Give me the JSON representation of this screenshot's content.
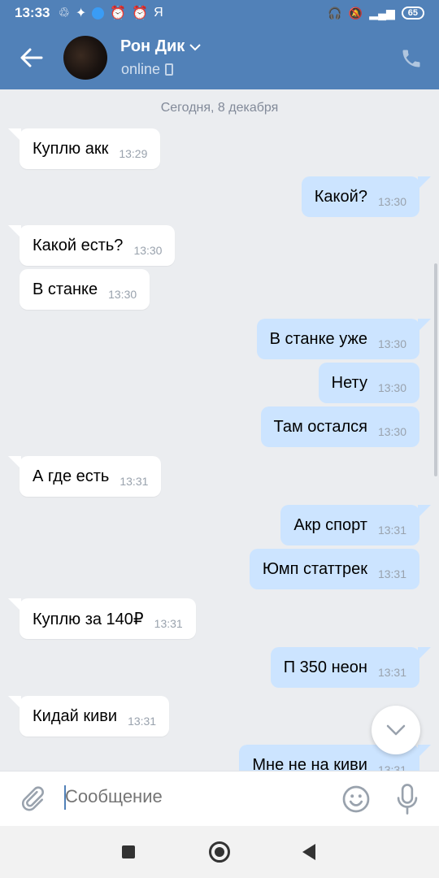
{
  "status": {
    "time": "13:33",
    "battery": "65",
    "carrier_glyph": "Я"
  },
  "contact": {
    "name": "Рон Дик",
    "presence": "online"
  },
  "chat": {
    "date_label": "Сегодня, 8 декабря",
    "messages": [
      {
        "dir": "in",
        "text": "Куплю акк",
        "time": "13:29"
      },
      {
        "dir": "out",
        "text": "Какой?",
        "time": "13:30"
      },
      {
        "dir": "in",
        "text": "Какой есть?",
        "time": "13:30"
      },
      {
        "dir": "in",
        "text": "В станке",
        "time": "13:30"
      },
      {
        "dir": "out",
        "text": "В станке уже",
        "time": "13:30"
      },
      {
        "dir": "out",
        "text": "Нету",
        "time": "13:30"
      },
      {
        "dir": "out",
        "text": "Там остался",
        "time": "13:30"
      },
      {
        "dir": "in",
        "text": "А где есть",
        "time": "13:31"
      },
      {
        "dir": "out",
        "text": "Акр спорт",
        "time": "13:31"
      },
      {
        "dir": "out",
        "text": "Юмп статтрек",
        "time": "13:31"
      },
      {
        "dir": "in",
        "text": "Куплю за 140₽",
        "time": "13:31"
      },
      {
        "dir": "out",
        "text": "П 350 неон",
        "time": "13:31"
      },
      {
        "dir": "in",
        "text": "Кидай киви",
        "time": "13:31"
      },
      {
        "dir": "out",
        "text": "Мне не на киви",
        "time": "13:31"
      }
    ]
  },
  "composer": {
    "placeholder": "Сообщение"
  },
  "icons": {
    "back": "arrow-left-icon",
    "phone": "phone-icon",
    "attach": "paperclip-icon",
    "emoji": "smile-icon",
    "mic": "microphone-icon",
    "scroll": "chevron-down-icon"
  },
  "colors": {
    "header": "#5181b8",
    "out_bubble": "#cce4ff",
    "in_bubble": "#ffffff",
    "background": "#ebedf0"
  }
}
